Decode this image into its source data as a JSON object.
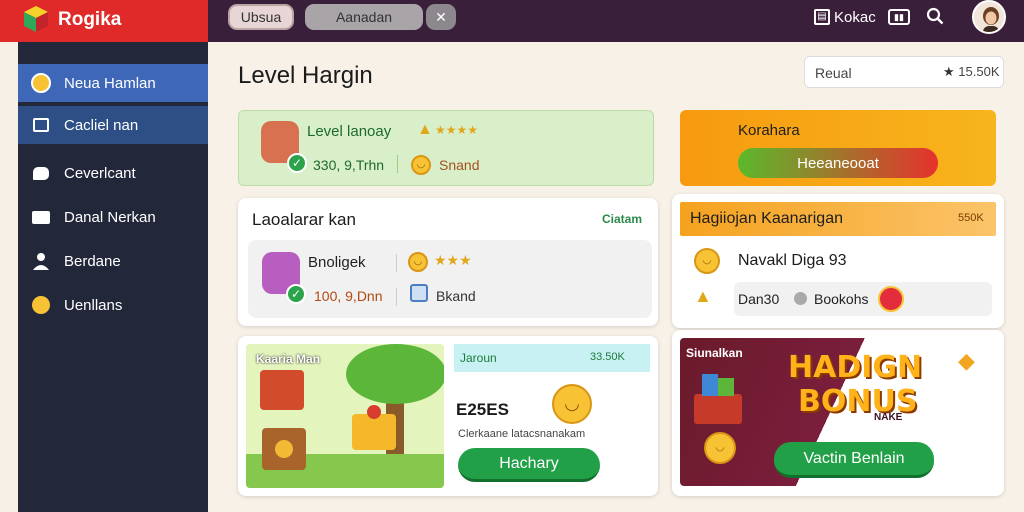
{
  "app": {
    "name": "Rogika"
  },
  "topbar": {
    "pill1": "Ubsua",
    "pill2": "Aanadan",
    "pill3_icon": "x",
    "right_label": "Kokac"
  },
  "sidebar": {
    "items": [
      {
        "label": "Neua Hamlan",
        "icon": "smile-coin-icon"
      },
      {
        "label": "Cacliel nan",
        "icon": "list-icon"
      },
      {
        "label": "Ceverlcant",
        "icon": "chat-icon"
      },
      {
        "label": "Danal Nerkan",
        "icon": "briefcase-icon"
      },
      {
        "label": "Berdane",
        "icon": "user-icon"
      },
      {
        "label": "Uenllans",
        "icon": "emoji-icon"
      }
    ]
  },
  "main": {
    "title": "Level Hargin",
    "search": {
      "label": "Reual",
      "score": "15.50K"
    },
    "green_card": {
      "title": "Level lanoay",
      "stars": "★★★★",
      "value": "330, 9,Trhn",
      "tag": "Snand"
    },
    "orange_card": {
      "title": "Korahara",
      "button": "Heeaneooat"
    },
    "list_card": {
      "title": "Laoalarar kan",
      "tag": "Ciatam",
      "item_title": "Bnoligek",
      "stars": "★★★",
      "value": "100, 9,Dnn",
      "tag2": "Bkand"
    },
    "bonus_card": {
      "title": "Hagiiojan Kaanarigan",
      "badge": "550K",
      "line1": "Navakl Diga 93",
      "line2": "Dan30",
      "line2_b": "Bookohs"
    },
    "promo_left": {
      "label": "Kaaria Man"
    },
    "promo_right": {
      "head": "Jaroun",
      "head_right": "33.50K",
      "code": "E25ES",
      "desc": "Clerkaane latacsnanakam",
      "button": "Hachary"
    },
    "bonus_banner": {
      "label": "Siunalkan",
      "big1": "HADIGN",
      "big2": "BONUS",
      "small": "NAKE",
      "button": "Vactin Benlain"
    }
  }
}
